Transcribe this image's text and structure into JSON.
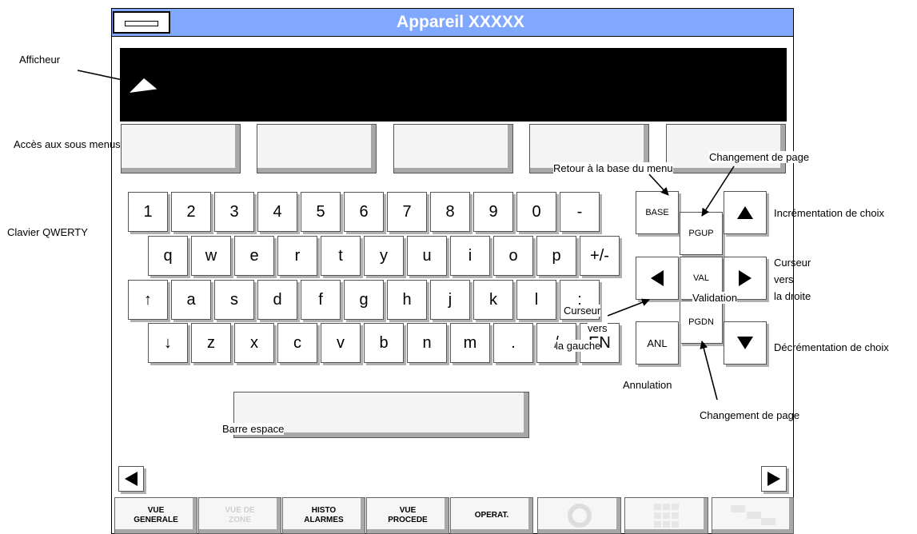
{
  "window": {
    "title": "Appareil XXXXX"
  },
  "annotations": {
    "afficheur": "Afficheur",
    "sous_menus": "Accès aux sous menus",
    "clavier": "Clavier QWERTY",
    "retour_base": "Retour à la base du menu",
    "chg_page_top": "Changement de page",
    "increment": "Incrémentation de choix",
    "curseur_droite_1": "Curseur",
    "curseur_droite_2": "vers",
    "curseur_droite_3": "la droite",
    "validation": "Validation",
    "curseur_gauche_1": "Curseur",
    "curseur_gauche_2": "vers",
    "curseur_gauche_3": "la gauche",
    "decrement": "Décrémentation de choix",
    "annulation": "Annulation",
    "chg_page_bottom": "Changement de page",
    "barre_espace": "Barre espace"
  },
  "keyboard": {
    "row1": [
      "1",
      "2",
      "3",
      "4",
      "5",
      "6",
      "7",
      "8",
      "9",
      "0",
      "-"
    ],
    "row2": [
      "q",
      "w",
      "e",
      "r",
      "t",
      "y",
      "u",
      "i",
      "o",
      "p",
      "+/-"
    ],
    "row3": [
      "↑",
      "a",
      "s",
      "d",
      "f",
      "g",
      "h",
      "j",
      "k",
      "l",
      ";"
    ],
    "row4": [
      "↓",
      "z",
      "x",
      "c",
      "v",
      "b",
      "n",
      "m",
      ".",
      "/",
      "EN"
    ]
  },
  "nav_keys": {
    "base": "BASE",
    "pgup": "PGUP",
    "val": "VAL",
    "pgdn": "PGDN",
    "anl": "ANL",
    "up_icon": "triangle-up-icon",
    "down_icon": "triangle-down-icon",
    "left_icon": "triangle-left-icon",
    "right_icon": "triangle-right-icon"
  },
  "bottom_tabs": [
    {
      "line1": "VUE",
      "line2": "GENERALE",
      "enabled": true
    },
    {
      "line1": "VUE DE",
      "line2": "ZONE",
      "enabled": false
    },
    {
      "line1": "HISTO",
      "line2": "ALARMES",
      "enabled": true
    },
    {
      "line1": "VUE",
      "line2": "PROCEDE",
      "enabled": true
    },
    {
      "line1": "OPERAT.",
      "line2": "",
      "enabled": true
    }
  ],
  "colors": {
    "title_bar": "#80a8ff",
    "display": "#000000"
  }
}
